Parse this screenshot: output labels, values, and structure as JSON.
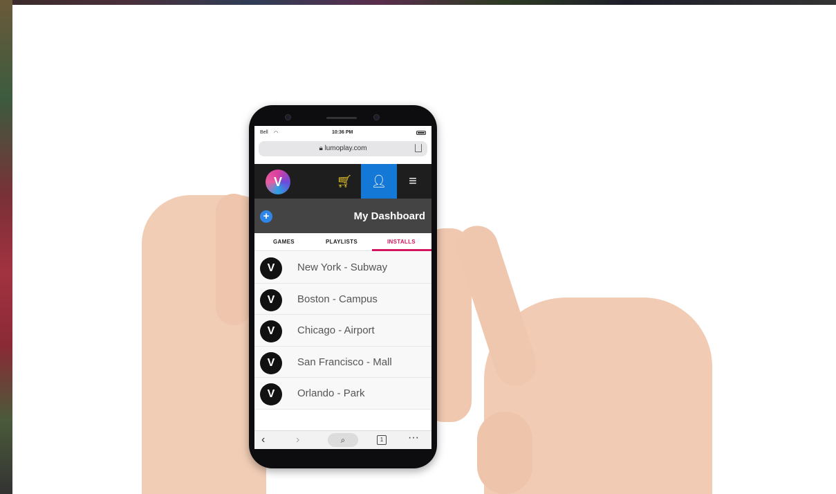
{
  "status": {
    "carrier": "Bell",
    "time": "10:36 PM"
  },
  "browser": {
    "url": "lumoplay.com"
  },
  "app": {
    "logo_icon": "lumoplay-logo-icon",
    "cart_icon": "cart-icon",
    "user_icon": "user-icon",
    "menu_icon": "menu-icon",
    "accent": "#1478d6"
  },
  "dashboard": {
    "title": "My Dashboard",
    "add_icon": "plus-circle-icon"
  },
  "tabs": [
    {
      "label": "GAMES"
    },
    {
      "label": "PLAYLISTS"
    },
    {
      "label": "INSTALLS",
      "active": true
    }
  ],
  "installs": [
    {
      "label": "New York - Subway"
    },
    {
      "label": "Boston - Campus"
    },
    {
      "label": "Chicago - Airport"
    },
    {
      "label": "San Francisco - Mall"
    },
    {
      "label": "Orlando - Park"
    }
  ],
  "toolbar": {
    "back_icon": "back-arrow-icon",
    "forward_icon": "forward-arrow-icon",
    "search_icon": "search-icon",
    "tabs_count": "1",
    "more_icon": "more-icon"
  },
  "colors": {
    "tab_active": "#d3155e",
    "app_bar": "#1e1e1e",
    "dash_bar": "#444444"
  }
}
